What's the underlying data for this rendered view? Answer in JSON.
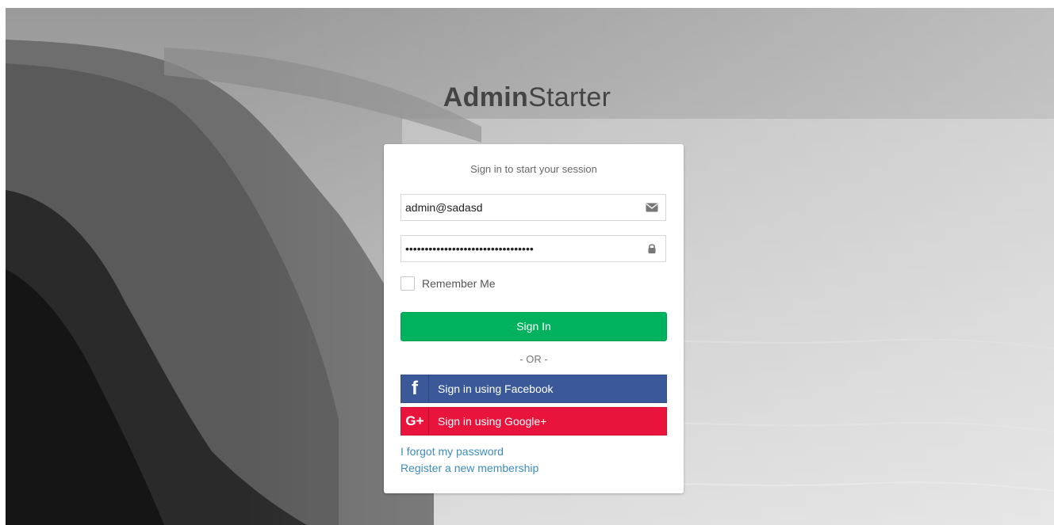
{
  "brand": {
    "bold": "Admin",
    "light": "Starter"
  },
  "login": {
    "message": "Sign in to start your session",
    "email": {
      "value": "admin@sadasd",
      "icon": "envelope-icon"
    },
    "password": {
      "value": "sssssssssssssssssssssssssssssssss",
      "icon": "lock-icon"
    },
    "remember_label": "Remember Me",
    "signin_label": "Sign In",
    "or_text": "- OR -",
    "facebook": {
      "icon_glyph": "f",
      "label": "Sign in using Facebook",
      "color": "#3b5998"
    },
    "google": {
      "icon_glyph": "G+",
      "label": "Sign in using Google+",
      "color": "#e8143c"
    },
    "forgot_link": "I forgot my password",
    "register_link": "Register a new membership"
  },
  "colors": {
    "signin_button": "#00b25d",
    "link": "#3c8dbc"
  }
}
